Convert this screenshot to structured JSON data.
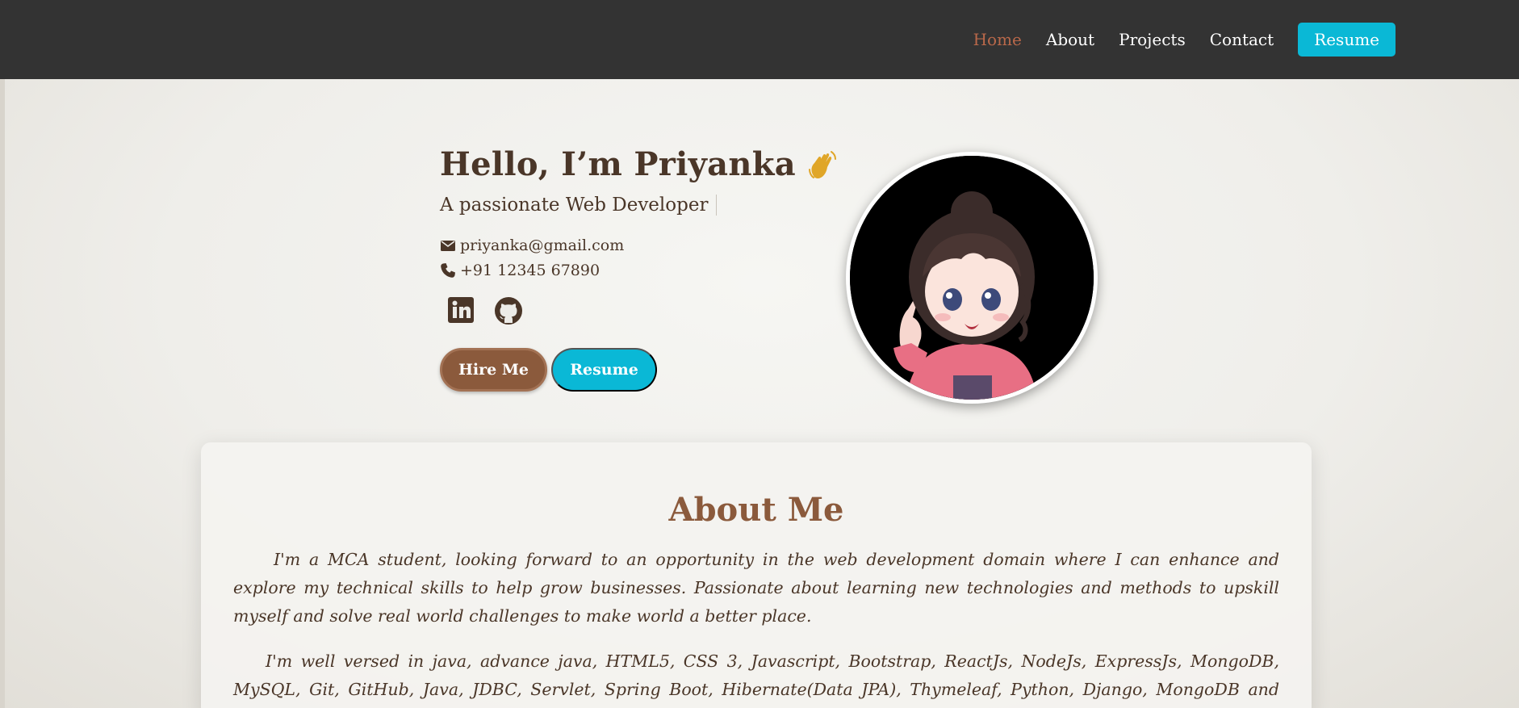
{
  "nav": {
    "items": [
      {
        "label": "Home",
        "active": true
      },
      {
        "label": "About",
        "active": false
      },
      {
        "label": "Projects",
        "active": false
      },
      {
        "label": "Contact",
        "active": false
      }
    ],
    "resume_label": "Resume"
  },
  "hero": {
    "title": "Hello, I’m Priyanka",
    "wave_icon": "waving-hand-icon",
    "subtitle": "A passionate Web Developer",
    "email": "priyanka@gmail.com",
    "phone": "+91 12345 67890",
    "socials": [
      "linkedin-icon",
      "github-icon"
    ],
    "hire_label": "Hire Me",
    "resume_label": "Resume"
  },
  "about": {
    "title": "About Me",
    "paragraphs": [
      "I'm a MCA student, looking forward to an opportunity in the web development domain where I can enhance and explore my technical skills to help grow businesses. Passionate about learning new technologies and methods to upskill myself and solve real world challenges to make world a better place.",
      "I'm well versed in java, advance java, HTML5, CSS 3, Javascript, Bootstrap, ReactJs, NodeJs, ExpressJs, MongoDB, MySQL, Git, GitHub, Java, JDBC, Servlet, Spring Boot, Hibernate(Data JPA), Thymeleaf, Python, Django, MongoDB and DevOps."
    ]
  },
  "colors": {
    "navbar": "#333333",
    "accent": "#0ab8d6",
    "brown": "#8b5a3c",
    "text": "#4a3628",
    "active_link": "#b9684a"
  }
}
